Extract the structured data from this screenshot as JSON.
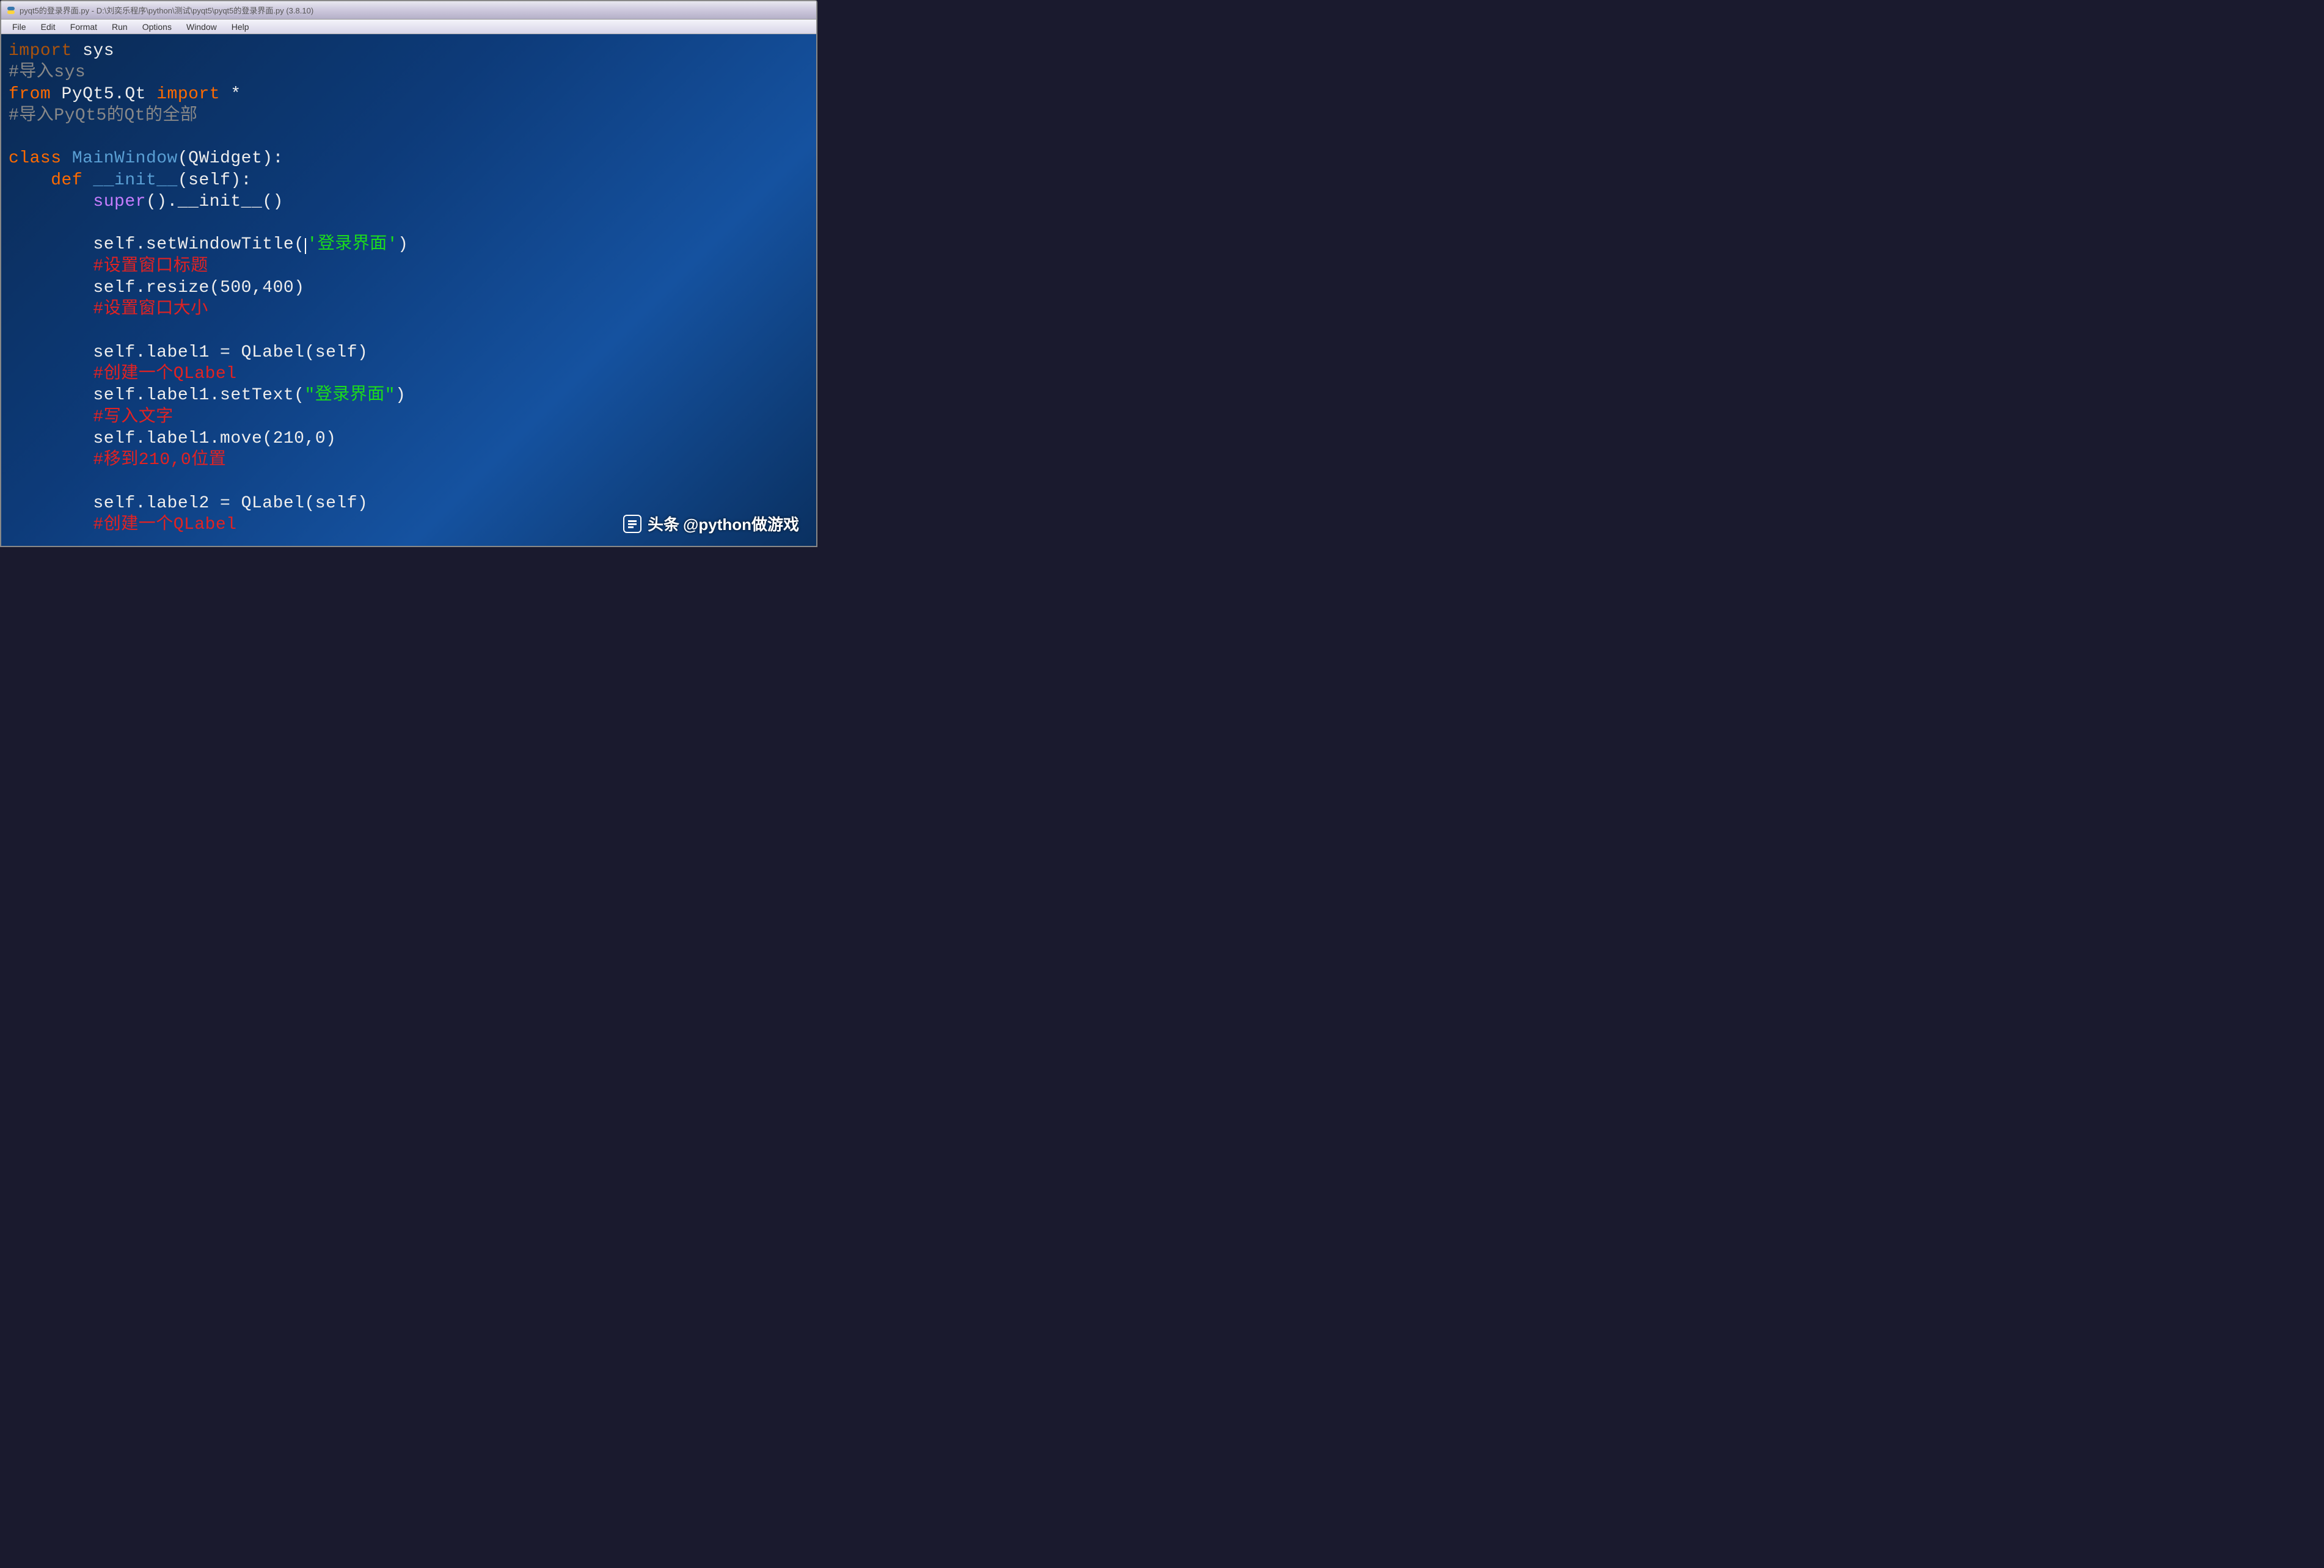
{
  "titlebar": {
    "text": "pyqt5的登录界面.py - D:\\刘奕乐程序\\python\\测试\\pyqt5\\pyqt5的登录界面.py (3.8.10)"
  },
  "menubar": {
    "items": [
      "File",
      "Edit",
      "Format",
      "Run",
      "Options",
      "Window",
      "Help"
    ]
  },
  "code": {
    "l1a": "import",
    "l1b": " sys",
    "l2": "#导入sys",
    "l3a": "from",
    "l3b": " PyQt5.Qt ",
    "l3c": "import",
    "l3d": " *",
    "l4": "#导入PyQt5的Qt的全部",
    "l5": "",
    "l6a": "class",
    "l6b": " MainWindow",
    "l6c": "(QWidget):",
    "l7a": "    def",
    "l7b": " __init__",
    "l7c": "(self):",
    "l8a": "        super",
    "l8b": "().__init__()",
    "l9": "",
    "l10a": "        self.setWindowTitle(",
    "l10b": "'登录界面'",
    "l10c": ")",
    "l11": "        #设置窗口标题",
    "l12a": "        self.resize(",
    "l12b": "500",
    "l12c": ",",
    "l12d": "400",
    "l12e": ")",
    "l13": "        #设置窗口大小",
    "l14": "",
    "l15": "        self.label1 = QLabel(self)",
    "l16": "        #创建一个QLabel",
    "l17a": "        self.label1.setText(",
    "l17b": "\"登录界面\"",
    "l17c": ")",
    "l18": "        #写入文字",
    "l19a": "        self.label1.move(",
    "l19b": "210",
    "l19c": ",",
    "l19d": "0",
    "l19e": ")",
    "l20": "        #移到210,0位置",
    "l21": "",
    "l22": "        self.label2 = QLabel(self)",
    "l23": "        #创建一个QLabel"
  },
  "watermark": {
    "brand": "头条",
    "handle": "@python做游戏"
  }
}
